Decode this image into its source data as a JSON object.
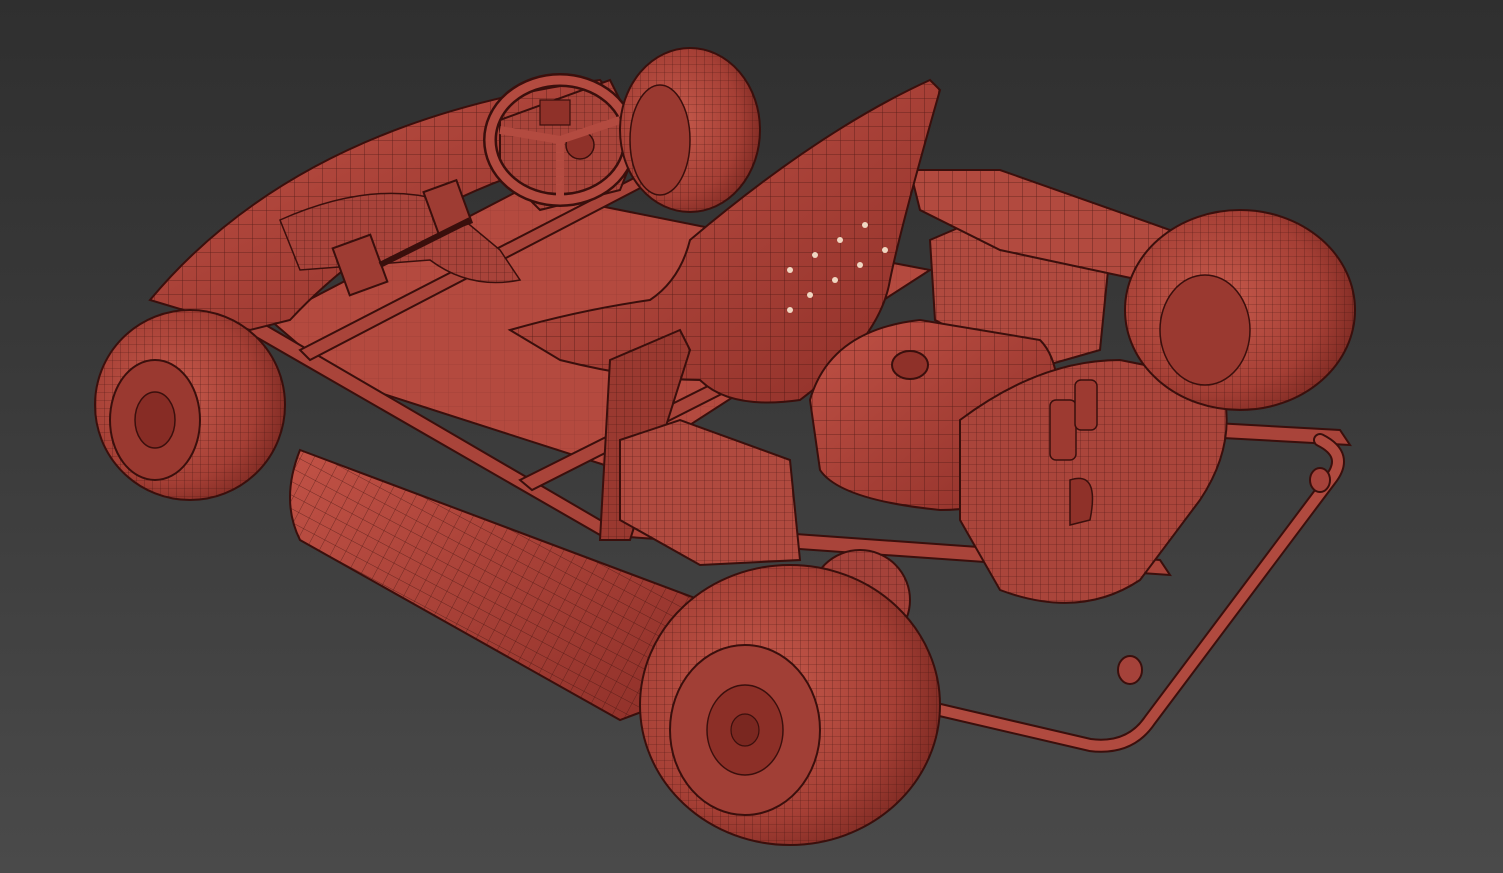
{
  "viewport": {
    "colors": {
      "background_top": "#2f2f2f",
      "background_bottom": "#4a4a4a",
      "mesh_fill": "#b5463c",
      "mesh_fill_dark": "#8e2f28",
      "mesh_fill_light": "#c85a4d",
      "wire": "#3a0f0c"
    },
    "subject": "go-kart-wireframe-model",
    "parts": [
      "front-left-wheel",
      "front-right-wheel",
      "rear-left-wheel",
      "rear-right-wheel",
      "steering-wheel",
      "dashboard",
      "seat",
      "floor-pan",
      "side-pod",
      "fuel-tank",
      "engine",
      "battery-front",
      "battery-rear",
      "rear-bumper",
      "pedals",
      "front-body"
    ]
  }
}
